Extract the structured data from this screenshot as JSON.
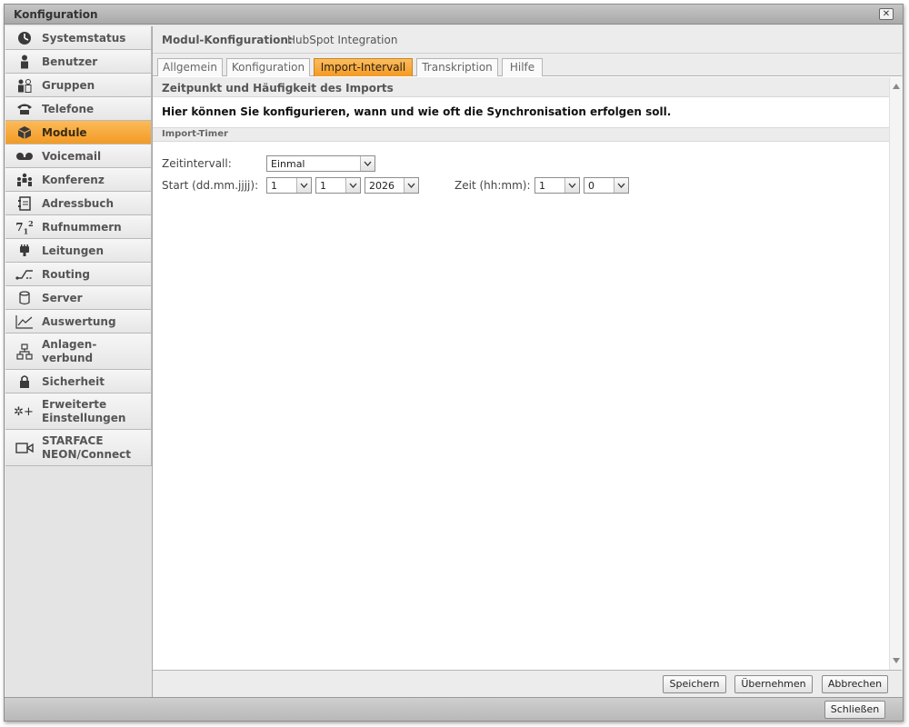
{
  "window": {
    "title": "Konfiguration",
    "close_icon": "close-icon"
  },
  "sidebar": {
    "items": [
      {
        "label": "Systemstatus",
        "icon": "gauge-icon"
      },
      {
        "label": "Benutzer",
        "icon": "user-icon"
      },
      {
        "label": "Gruppen",
        "icon": "group-icon"
      },
      {
        "label": "Telefone",
        "icon": "phone-icon"
      },
      {
        "label": "Module",
        "icon": "module-icon",
        "active": true
      },
      {
        "label": "Voicemail",
        "icon": "voicemail-icon"
      },
      {
        "label": "Konferenz",
        "icon": "conference-icon"
      },
      {
        "label": "Adressbuch",
        "icon": "addressbook-icon"
      },
      {
        "label": "Rufnummern",
        "icon": "numbers-icon"
      },
      {
        "label": "Leitungen",
        "icon": "plug-icon"
      },
      {
        "label": "Routing",
        "icon": "routing-icon"
      },
      {
        "label": "Server",
        "icon": "server-icon"
      },
      {
        "label": "Auswertung",
        "icon": "chart-icon"
      },
      {
        "label_line1": "Anlagen-",
        "label_line2": "verbund",
        "icon": "network-icon"
      },
      {
        "label": "Sicherheit",
        "icon": "lock-icon"
      },
      {
        "label_line1": "Erweiterte",
        "label_line2": "Einstellungen",
        "icon": "advanced-settings-icon"
      },
      {
        "label_line1": "STARFACE",
        "label_line2": "NEON/Connect",
        "icon": "video-icon"
      }
    ]
  },
  "module_header": {
    "label": "Modul-Konfiguration:",
    "value": "HubSpot Integration"
  },
  "tabs": [
    {
      "label": "Allgemein"
    },
    {
      "label": "Konfiguration"
    },
    {
      "label": "Import-Intervall",
      "active": true
    },
    {
      "label": "Transkription"
    },
    {
      "label": "Hilfe"
    }
  ],
  "section": {
    "title": "Zeitpunkt und Häufigkeit des Imports",
    "description": "Hier können Sie konfigurieren, wann und wie oft die Synchronisation erfolgen soll.",
    "subsection": "Import-Timer"
  },
  "form": {
    "interval_label": "Zeitintervall:",
    "interval_value": "Einmal",
    "start_label": "Start (dd.mm.jjjj):",
    "start_day": "1",
    "start_month": "1",
    "start_year": "2026",
    "time_label": "Zeit (hh:mm):",
    "time_hour": "1",
    "time_minute": "0"
  },
  "footer": {
    "save": "Speichern",
    "apply": "Übernehmen",
    "cancel": "Abbrechen"
  },
  "bottom": {
    "close": "Schließen"
  },
  "colors": {
    "accent": "#f39b25",
    "panel_bg": "#ececec"
  }
}
